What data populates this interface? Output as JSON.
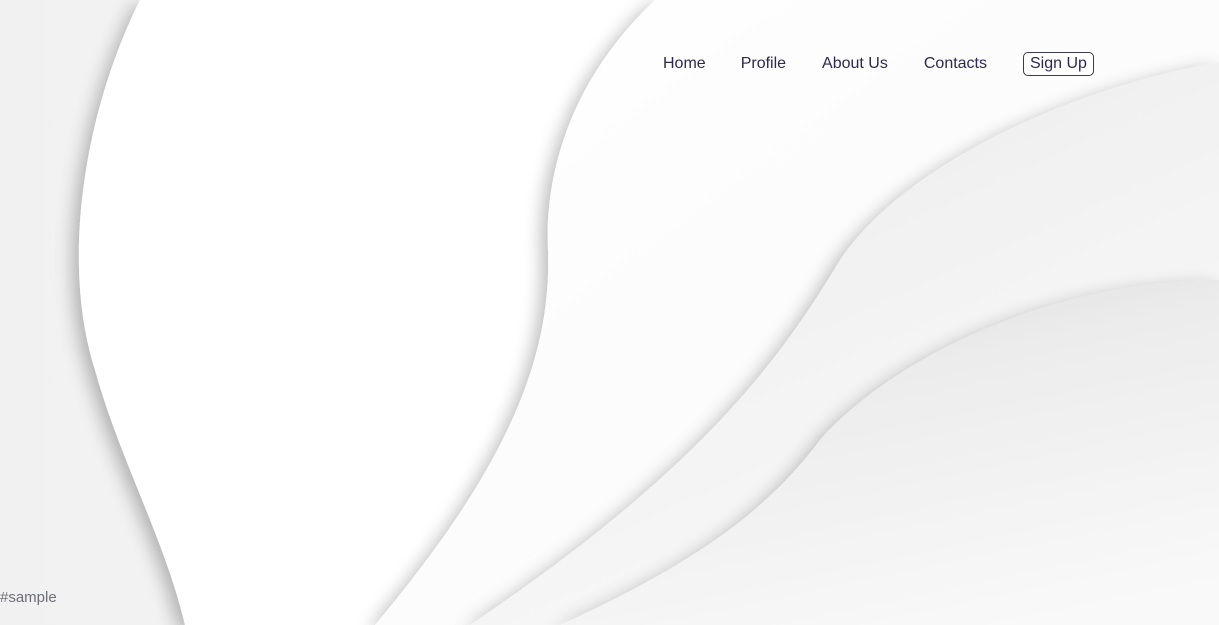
{
  "nav": {
    "links": [
      {
        "label": "Home"
      },
      {
        "label": "Profile"
      },
      {
        "label": "About Us"
      },
      {
        "label": "Contacts"
      }
    ],
    "signup_label": "Sign Up"
  },
  "footer": {
    "tag": "#sample"
  },
  "colors": {
    "nav_text": "#2c2a4e",
    "background": "#ffffff",
    "wave_shadow": "#d6d6d6"
  }
}
